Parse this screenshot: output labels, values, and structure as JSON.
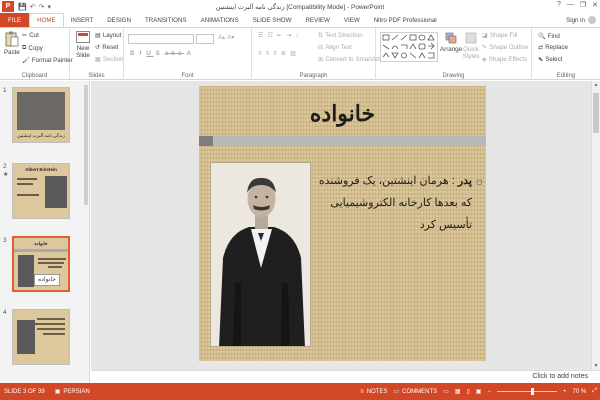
{
  "titlebar": {
    "logo_text": "P",
    "title": "زندگی نامه آلبرت اینشتین [Compatibility Mode] - PowerPoint",
    "qat": [
      "💾",
      "↶",
      "↷",
      "▾"
    ],
    "help": "?",
    "controls": [
      "—",
      "❐",
      "✕"
    ]
  },
  "tabs": [
    "FILE",
    "HOME",
    "INSERT",
    "DESIGN",
    "TRANSITIONS",
    "ANIMATIONS",
    "SLIDE SHOW",
    "REVIEW",
    "VIEW",
    "Nitro PDF Professional"
  ],
  "signin": "Sign in",
  "ribbon": {
    "clipboard": {
      "paste": "Paste",
      "cut": "Cut",
      "copy": "Copy",
      "format_painter": "Format Painter",
      "label": "Clipboard"
    },
    "slides": {
      "new_slide": "New Slide",
      "layout": "Layout",
      "reset": "Reset",
      "section": "Section",
      "label": "Slides"
    },
    "font": {
      "label": "Font"
    },
    "paragraph": {
      "text_direction": "Text Direction",
      "align_text": "Align Text",
      "smartart": "Convert to SmartArt",
      "label": "Paragraph"
    },
    "drawing": {
      "arrange": "Arrange",
      "quick_styles": "Quick Styles",
      "shape_fill": "Shape Fill",
      "shape_outline": "Shape Outline",
      "shape_effects": "Shape Effects",
      "label": "Drawing"
    },
    "editing": {
      "find": "Find",
      "replace": "Replace",
      "select": "Select",
      "label": "Editing"
    }
  },
  "thumbnails": [
    {
      "num": "1",
      "caption": "زندگی نامه آلبرت اینشتین"
    },
    {
      "num": "2",
      "star": "★",
      "title": "Albert Einstein"
    },
    {
      "num": "3",
      "title": "خانواده",
      "caption": "خانواده"
    },
    {
      "num": "4"
    }
  ],
  "slide": {
    "title": "خانواده",
    "lead": "پدر",
    "body": ": هرمان اینشتین، یک فروشنده که بعدها کارخانه الکتروشیمیایی تأسیس کرد",
    "bullet": "◻"
  },
  "notes_hint": "Click to add notes",
  "status": {
    "slide_info": "SLIDE 3 OF 39",
    "language": "PERSIAN",
    "notes": "NOTES",
    "comments": "COMMENTS",
    "zoom": "70 %",
    "zoom_fraction": 0.6
  },
  "colors": {
    "accent": "#d24726",
    "slide_bg": "#d8c08c"
  }
}
